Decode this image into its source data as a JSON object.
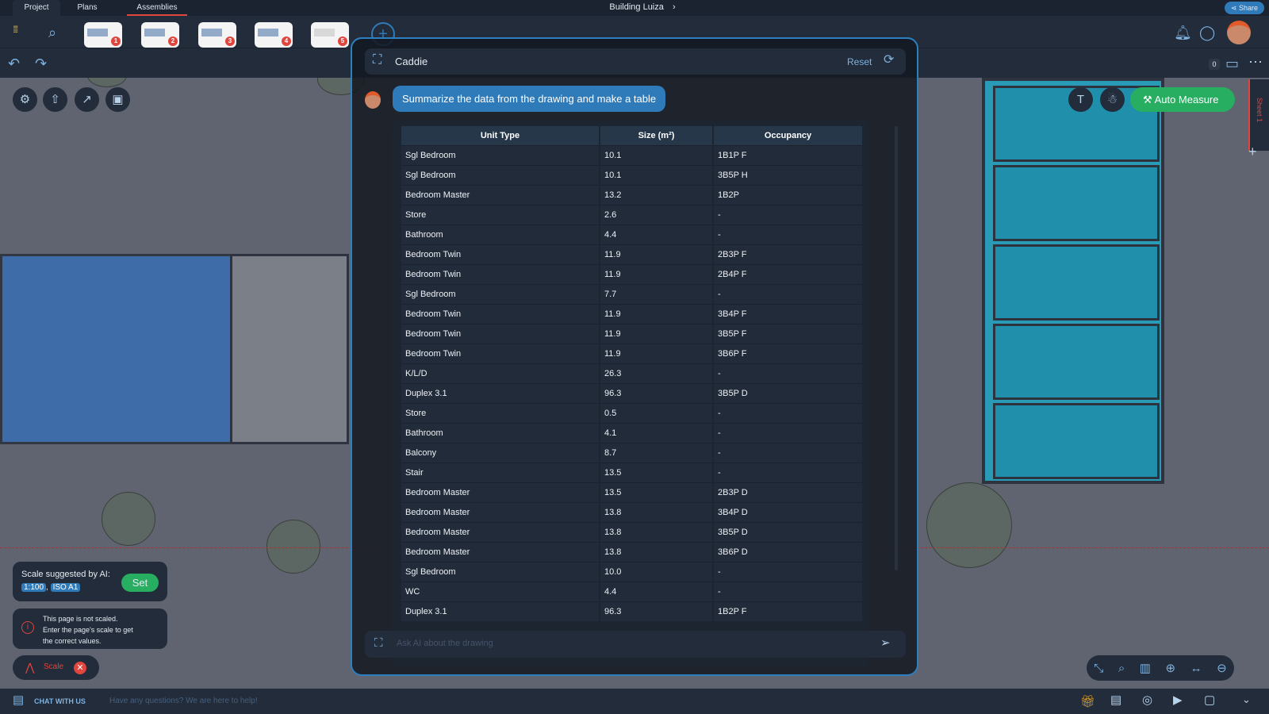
{
  "tabs": [
    {
      "label": "Project"
    },
    {
      "label": "Plans"
    },
    {
      "label": "Assemblies"
    }
  ],
  "title": "Building Luiza",
  "share_label": "Share",
  "thumbnails": [
    "1",
    "2",
    "3",
    "4",
    "5"
  ],
  "notification_count": "0",
  "sheet_label": "Sheet 1",
  "caddie": {
    "title": "Caddie",
    "reset_label": "Reset",
    "user_message": "Summarize the data from the drawing and make a table",
    "input_placeholder": "Ask AI about the drawing"
  },
  "table": {
    "headers": [
      "Unit Type",
      "Size (m²)",
      "Occupancy"
    ],
    "rows": [
      [
        "Sgl Bedroom",
        "10.1",
        "1B1P F"
      ],
      [
        "Sgl Bedroom",
        "10.1",
        "3B5P H"
      ],
      [
        "Bedroom Master",
        "13.2",
        "1B2P"
      ],
      [
        "Store",
        "2.6",
        "-"
      ],
      [
        "Bathroom",
        "4.4",
        "-"
      ],
      [
        "Bedroom Twin",
        "11.9",
        "2B3P F"
      ],
      [
        "Bedroom Twin",
        "11.9",
        "2B4P F"
      ],
      [
        "Sgl Bedroom",
        "7.7",
        "-"
      ],
      [
        "Bedroom Twin",
        "11.9",
        "3B4P F"
      ],
      [
        "Bedroom Twin",
        "11.9",
        "3B5P F"
      ],
      [
        "Bedroom Twin",
        "11.9",
        "3B6P F"
      ],
      [
        "K/L/D",
        "26.3",
        "-"
      ],
      [
        "Duplex 3.1",
        "96.3",
        "3B5P D"
      ],
      [
        "Store",
        "0.5",
        "-"
      ],
      [
        "Bathroom",
        "4.1",
        "-"
      ],
      [
        "Balcony",
        "8.7",
        "-"
      ],
      [
        "Stair",
        "13.5",
        "-"
      ],
      [
        "Bedroom Master",
        "13.5",
        "2B3P D"
      ],
      [
        "Bedroom Master",
        "13.8",
        "3B4P D"
      ],
      [
        "Bedroom Master",
        "13.8",
        "3B5P D"
      ],
      [
        "Bedroom Master",
        "13.8",
        "3B6P D"
      ],
      [
        "Sgl Bedroom",
        "10.0",
        "-"
      ],
      [
        "WC",
        "4.4",
        "-"
      ],
      [
        "Duplex 3.1",
        "96.3",
        "1B2P F"
      ]
    ]
  },
  "auto_measure_label": "Auto Measure",
  "scale_panel": {
    "title": "Scale suggested by AI:",
    "scale": "1:100",
    "paper": "ISO A1",
    "set_label": "Set"
  },
  "warning": {
    "line1": "This page is not scaled.",
    "line2": "Enter the page's scale to get",
    "line3": "the correct values."
  },
  "scale_button_label": "Scale",
  "bottom": {
    "chat_label": "CHAT WITH US",
    "help_text": "Have any questions? We are here to help!"
  },
  "colors": {
    "accent": "#2f7ab8",
    "green": "#27ae60",
    "danger": "#e0453e"
  }
}
